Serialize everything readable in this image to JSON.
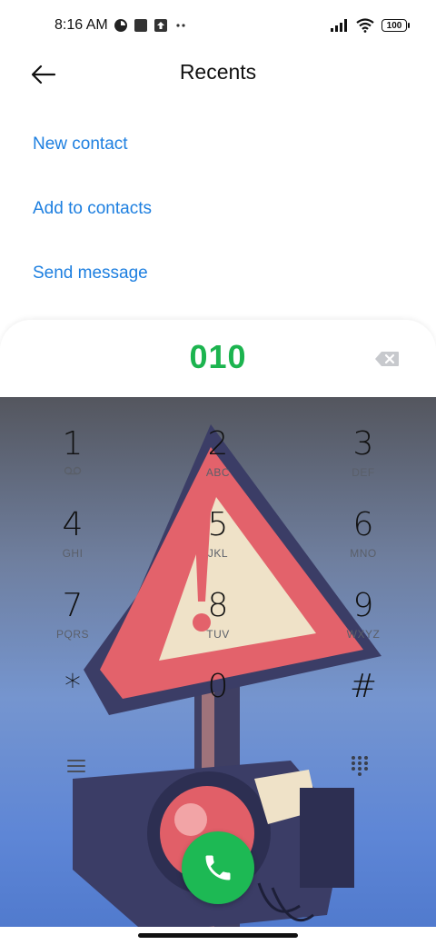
{
  "status_bar": {
    "time": "8:16 AM",
    "icons": [
      "data-saver-icon",
      "square-notification-icon",
      "upload-icon",
      "more-notifications-icon"
    ],
    "right_icons": [
      "signal-icon",
      "wifi-icon",
      "battery-icon"
    ],
    "battery_level": "100"
  },
  "header": {
    "title": "Recents",
    "back_icon": "arrow-left-icon"
  },
  "actions": {
    "new_contact": "New contact",
    "add_to_contacts": "Add to contacts",
    "send_message": "Send message"
  },
  "dialer": {
    "number": "010",
    "backspace_icon": "backspace-icon",
    "keys": [
      {
        "digit": "1",
        "letters": ""
      },
      {
        "digit": "2",
        "letters": "ABC"
      },
      {
        "digit": "3",
        "letters": "DEF"
      },
      {
        "digit": "4",
        "letters": "GHI"
      },
      {
        "digit": "5",
        "letters": "JKL"
      },
      {
        "digit": "6",
        "letters": "MNO"
      },
      {
        "digit": "7",
        "letters": "PQRS"
      },
      {
        "digit": "8",
        "letters": "TUV"
      },
      {
        "digit": "9",
        "letters": "WXYZ"
      },
      {
        "digit": "*",
        "letters": ""
      },
      {
        "digit": "0",
        "letters": ""
      },
      {
        "digit": "#",
        "letters": ""
      }
    ],
    "key1_extra_icon": "voicemail-icon",
    "left_util_icon": "menu-icon",
    "right_util_icon": "dialpad-icon",
    "call_icon": "phone-icon",
    "accent_color": "#1db954",
    "number_color": "#1cb44f",
    "action_color": "#1d7fe0"
  }
}
